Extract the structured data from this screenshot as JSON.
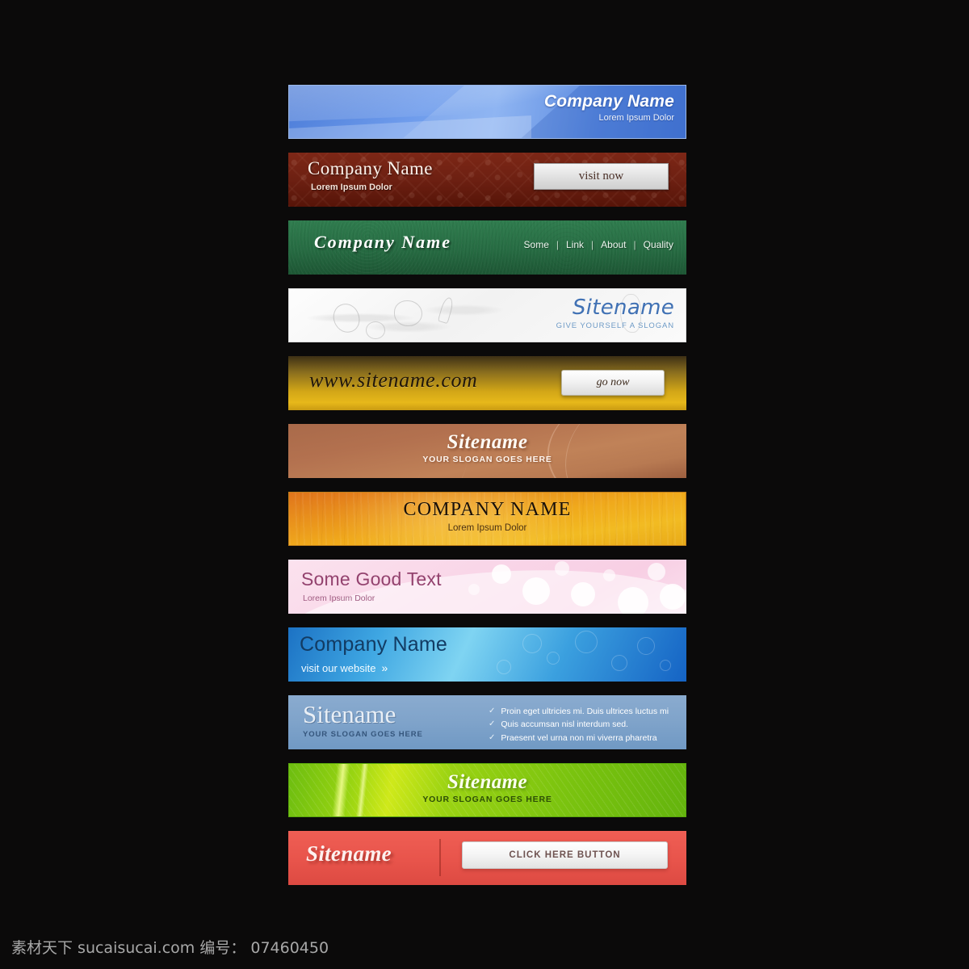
{
  "page": {
    "background_color": "#0b0a0a",
    "footer_credit": "素材天下 sucaisucai.com  编号： 07460450"
  },
  "banners": [
    {
      "id": "blue-polygon",
      "style": "blue-polygon-gradient",
      "title": "Company Name",
      "subtitle": "Lorem Ipsum Dolor",
      "colors": {
        "base": "#5b8ae0",
        "text": "#ffffff"
      }
    },
    {
      "id": "red-damask",
      "style": "dark-red-damask-pattern",
      "title": "Company Name",
      "subtitle": "Lorem Ipsum Dolor",
      "button_label": "visit now",
      "colors": {
        "base": "#6d2012",
        "text": "#fdf3ec",
        "button": "#e2e2e2"
      }
    },
    {
      "id": "green-felt",
      "style": "green-felt-texture",
      "title": "Company Name",
      "nav": [
        "Some",
        "Link",
        "About",
        "Quality"
      ],
      "nav_separator": "|",
      "colors": {
        "base": "#266b42",
        "text": "#ffffff"
      }
    },
    {
      "id": "white-paper",
      "style": "white-crumpled-paper-sketch",
      "title": "Sitename",
      "subtitle": "GIVE YOURSELF A SLOGAN",
      "colors": {
        "base": "#f7f7f7",
        "text": "#4071b4",
        "subtext": "#6d9ac6"
      }
    },
    {
      "id": "gold-www",
      "style": "gold-gradient",
      "title": "www.sitename.com",
      "button_label": "go now",
      "colors": {
        "base": "#d2a617",
        "text": "#20160a",
        "button": "#f2f2f2"
      }
    },
    {
      "id": "copper-swoosh",
      "style": "copper-brown-swoosh",
      "title": "Sitename",
      "subtitle": "YOUR SLOGAN GOES HERE",
      "colors": {
        "base": "#b3714f",
        "text": "#fffaf4"
      }
    },
    {
      "id": "orange-grunge",
      "style": "orange-grunge-texture",
      "title": "COMPANY NAME",
      "subtitle": "Lorem Ipsum Dolor",
      "colors": {
        "base": "#f0aa1c",
        "text": "#1a1008"
      }
    },
    {
      "id": "pink-bokeh",
      "style": "pink-bokeh-lights",
      "title": "Some Good Text",
      "subtitle": "Lorem Ipsum Dolor",
      "colors": {
        "base": "#f9d6e8",
        "text": "#93426e"
      }
    },
    {
      "id": "blue-bubbles",
      "style": "bright-blue-bubbles",
      "title": "Company Name",
      "subtitle": "visit our website",
      "arrow_glyph": "»",
      "colors": {
        "base": "#3ea6e2",
        "text": "#123b63",
        "subtext": "#f2fbff"
      }
    },
    {
      "id": "slate-list",
      "style": "slate-blue-with-checklist",
      "title": "Sitename",
      "subtitle": "YOUR SLOGAN GOES HERE",
      "check_glyph": "✓",
      "list_items": [
        "Proin eget ultricies mi. Duis ultrices luctus mi",
        "Quis accumsan nisl interdum sed.",
        "Praesent vel urna non mi viverra pharetra"
      ],
      "colors": {
        "base": "#7fa3ca",
        "text": "#e9eff6",
        "subtext": "#35567c"
      }
    },
    {
      "id": "green-leaf",
      "style": "green-leaf-streaks",
      "title": "Sitename",
      "subtitle": "YOUR SLOGAN GOES HERE",
      "colors": {
        "base": "#8acb11",
        "text": "#fbffee",
        "subtext": "#2d4f06"
      }
    },
    {
      "id": "red-cta",
      "style": "flat-red-with-button",
      "title": "Sitename",
      "button_label": "CLICK HERE  BUTTON",
      "colors": {
        "base": "#e8544b",
        "text": "#fdf1ef",
        "button": "#f6f6f6"
      }
    }
  ]
}
